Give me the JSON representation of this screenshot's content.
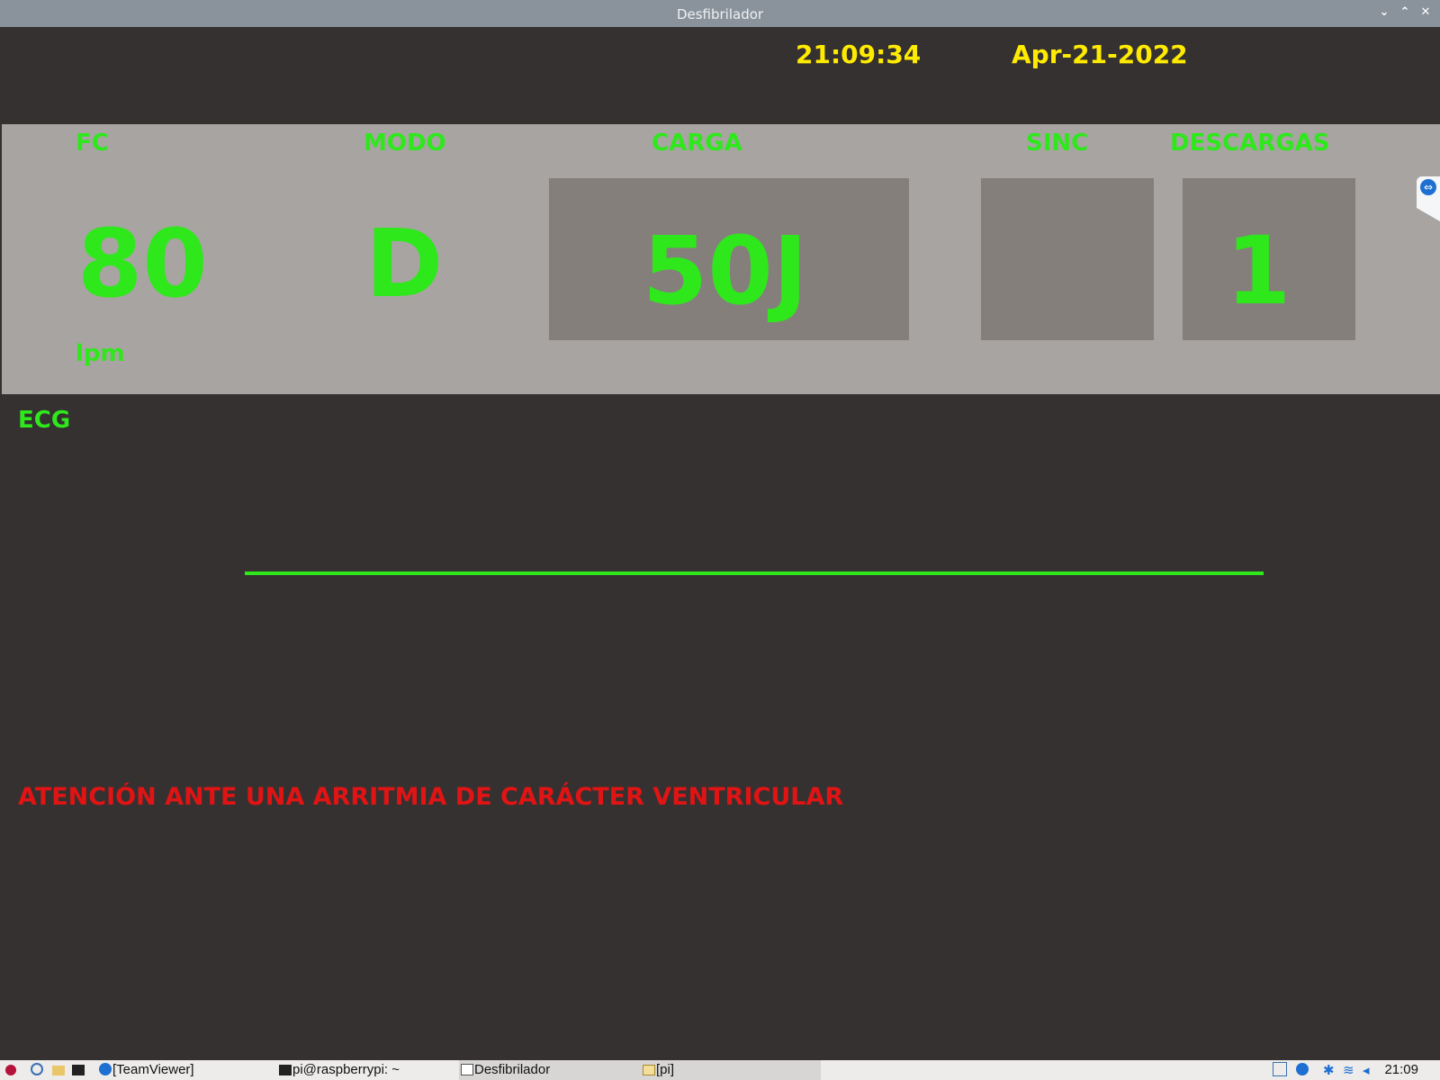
{
  "window": {
    "title": "Desfibrilador"
  },
  "header": {
    "time": "21:09:34",
    "date": "Apr-21-2022"
  },
  "panel": {
    "fc_label": "FC",
    "fc_value": "80",
    "fc_unit": "lpm",
    "modo_label": "MODO",
    "modo_value": "D",
    "carga_label": "CARGA",
    "carga_value": "50J",
    "sinc_label": "SINC",
    "sinc_value": "",
    "descargas_label": "DESCARGAS",
    "descargas_value": "1"
  },
  "ecg": {
    "label": "ECG"
  },
  "alert": {
    "message": "ATENCIÓN ANTE UNA ARRITMIA DE CARÁCTER VENTRICULAR"
  },
  "taskbar": {
    "items": [
      "[TeamViewer]",
      "pi@raspberrypi: ~",
      "Desfibrilador",
      "[pi]"
    ],
    "clock": "21:09"
  },
  "colors": {
    "value": "#2ee81c",
    "header_text": "#ffeb00",
    "alert": "#e01414",
    "background": "#353131",
    "panel": "#a8a4a2",
    "box": "#847f7b"
  }
}
